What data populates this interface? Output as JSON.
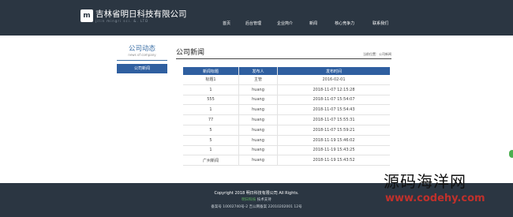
{
  "header": {
    "logo_mark": "m",
    "company_cn": "吉林省明日科技有限公司",
    "company_en": "jilin mingri sci. &. LTD",
    "nav": [
      "首页",
      "后台管理",
      "企业简介",
      "新闻",
      "核心竞争力",
      "联系我们"
    ]
  },
  "sidebar": {
    "title": "公司动态",
    "subtitle": "news of company",
    "active_item": "公司新闻"
  },
  "main": {
    "title": "公司新闻",
    "breadcrumb": "当前位置：公司新闻"
  },
  "table": {
    "headers": [
      "新闻标题",
      "发布人",
      "发布时间"
    ],
    "rows": [
      [
        "标题1",
        "主管",
        "2016-02-01"
      ],
      [
        "1",
        "huang",
        "2018-11-07 12:15:28"
      ],
      [
        "555",
        "huang",
        "2018-11-07 15:54:07"
      ],
      [
        "1",
        "huang",
        "2018-11-07 15:54:43"
      ],
      [
        "77",
        "huang",
        "2018-11-07 15:55:31"
      ],
      [
        "5",
        "huang",
        "2018-11-07 15:59:21"
      ],
      [
        "5",
        "huang",
        "2018-11-19 15:46:02"
      ],
      [
        "1",
        "huang",
        "2018-11-19 15:43:25"
      ],
      [
        "广州新闻",
        "huang",
        "2018-11-19 15:43:52"
      ]
    ]
  },
  "footer": {
    "copyright": "Copyright 2018 明日科技有限公司 All Rights.",
    "support_brand": "明日科技",
    "support_text": " 技术支持",
    "icp": "备案号 10002740号-2  吉公网备案 22010202001 12号"
  },
  "watermark": {
    "cn": "源码海洋网",
    "url": "www.codehy.com"
  }
}
